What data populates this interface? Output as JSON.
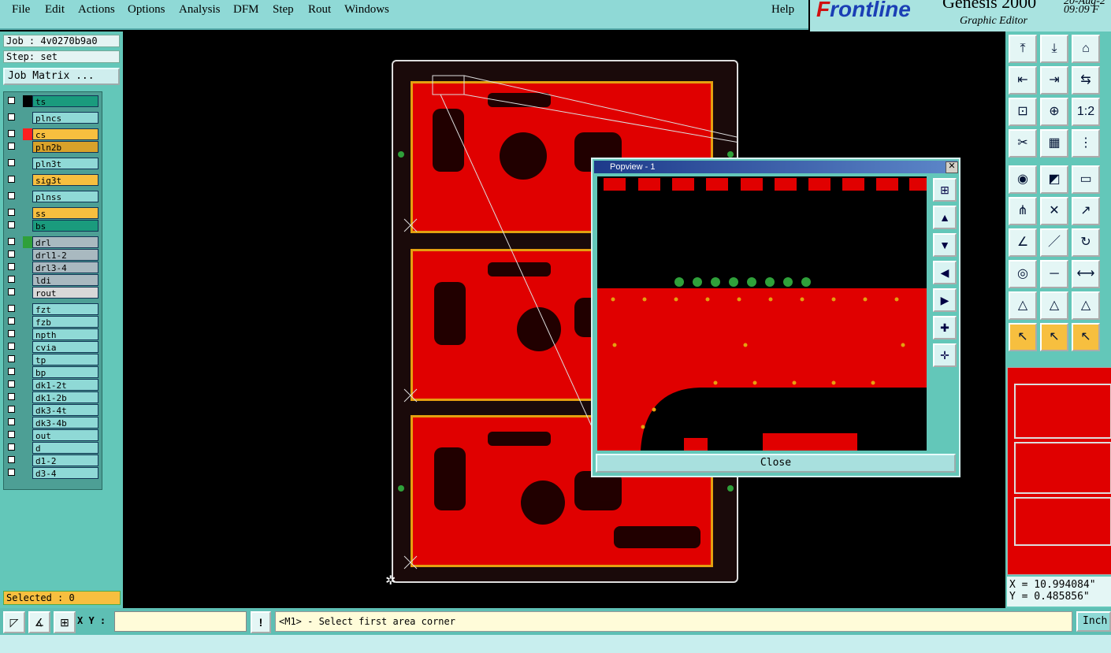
{
  "menu": [
    "File",
    "Edit",
    "Actions",
    "Options",
    "Analysis",
    "DFM",
    "Step",
    "Rout",
    "Windows"
  ],
  "help": "Help",
  "brand": {
    "logo_a": "F",
    "logo_b": "rontline",
    "product": "Genesis 2000",
    "subtitle": "Graphic Editor",
    "date": "20-Aug-2",
    "time": "09:09 F"
  },
  "job": "Job : 4v0270b9a0",
  "step": "Step: set",
  "job_matrix": "Job Matrix ...",
  "layers": [
    {
      "name": "ts",
      "bg": "#1a9b7d",
      "sw": "#000000"
    },
    {
      "name": "plncs",
      "bg": "#8fd9d6",
      "sw": ""
    },
    {
      "name": "cs",
      "bg": "#f7bf3f",
      "sw": "#ff2020"
    },
    {
      "name": "pln2b",
      "bg": "#d9a22a",
      "sw": ""
    },
    {
      "name": "pln3t",
      "bg": "#8fd9d6",
      "sw": ""
    },
    {
      "name": "sig3t",
      "bg": "#f7bf3f",
      "sw": ""
    },
    {
      "name": "plnss",
      "bg": "#8fd9d6",
      "sw": ""
    },
    {
      "name": "ss",
      "bg": "#f7bf3f",
      "sw": ""
    },
    {
      "name": "bs",
      "bg": "#1a9b7d",
      "sw": ""
    },
    {
      "name": "drl",
      "bg": "#a9b9c0",
      "sw": "#2fa03a"
    },
    {
      "name": "drl1-2",
      "bg": "#a9b9c0",
      "sw": ""
    },
    {
      "name": "drl3-4",
      "bg": "#a9b9c0",
      "sw": ""
    },
    {
      "name": "ldi",
      "bg": "#a9b9c0",
      "sw": ""
    },
    {
      "name": "rout",
      "bg": "#d8d8d8",
      "sw": ""
    },
    {
      "name": "fzt",
      "bg": "#8fd9d6",
      "sw": ""
    },
    {
      "name": "fzb",
      "bg": "#8fd9d6",
      "sw": ""
    },
    {
      "name": "npth",
      "bg": "#8fd9d6",
      "sw": ""
    },
    {
      "name": "cvia",
      "bg": "#8fd9d6",
      "sw": ""
    },
    {
      "name": "tp",
      "bg": "#8fd9d6",
      "sw": ""
    },
    {
      "name": "bp",
      "bg": "#8fd9d6",
      "sw": ""
    },
    {
      "name": "dk1-2t",
      "bg": "#8fd9d6",
      "sw": ""
    },
    {
      "name": "dk1-2b",
      "bg": "#8fd9d6",
      "sw": ""
    },
    {
      "name": "dk3-4t",
      "bg": "#8fd9d6",
      "sw": ""
    },
    {
      "name": "dk3-4b",
      "bg": "#8fd9d6",
      "sw": ""
    },
    {
      "name": "out",
      "bg": "#8fd9d6",
      "sw": ""
    },
    {
      "name": "d",
      "bg": "#8fd9d6",
      "sw": ""
    },
    {
      "name": "d1-2",
      "bg": "#8fd9d6",
      "sw": ""
    },
    {
      "name": "d3-4",
      "bg": "#8fd9d6",
      "sw": ""
    }
  ],
  "selected": "Selected : 0",
  "popview": {
    "title": "Popview - 1",
    "close_x": "✕",
    "close_button": "Close"
  },
  "coords": {
    "x": "X = 10.994084\"",
    "y": "Y = 0.485856\""
  },
  "xy_label": "X Y :",
  "xy_input_value": "",
  "prompt": "<M1> - Select first area corner",
  "units": "Inch",
  "colors": {
    "copper": "#e00000",
    "outline": "#e4a010",
    "panel_bg": "#63c7b9"
  }
}
